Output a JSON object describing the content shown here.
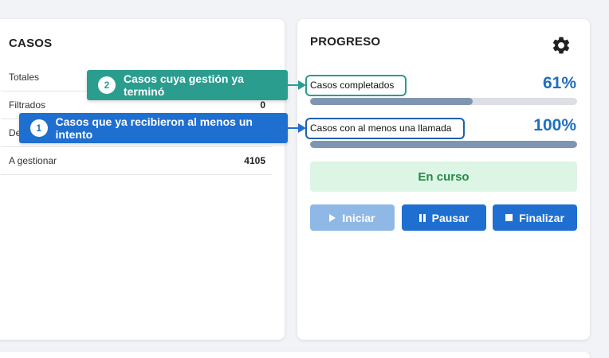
{
  "casos": {
    "title": "CASOS",
    "rows": [
      {
        "label": "Totales",
        "value": ""
      },
      {
        "label": "Filtrados",
        "value": "0"
      },
      {
        "label": "De",
        "value": ""
      },
      {
        "label": "A gestionar",
        "value": "4105"
      }
    ]
  },
  "progreso": {
    "title": "PROGRESO",
    "settings_icon": "gear-icon",
    "metrics": [
      {
        "label": "Casos completados",
        "percent_text": "61%",
        "percent": 61
      },
      {
        "label": "Casos con al menos una llamada",
        "percent_text": "100%",
        "percent": 100
      }
    ],
    "status": "En curso",
    "buttons": {
      "start": "Iniciar",
      "pause": "Pausar",
      "finish": "Finalizar"
    }
  },
  "tooltips": [
    {
      "number": "2",
      "text": "Casos cuya gestión ya terminó",
      "color": "#2a9d8f"
    },
    {
      "number": "1",
      "text": "Casos que ya recibieron al menos un intento",
      "color": "#1f6fd1"
    }
  ],
  "colors": {
    "accent_blue": "#1f6fd1",
    "percent_blue": "#1f6fbf",
    "status_green": "#27894a",
    "tooltip_teal": "#2a9d8f"
  }
}
